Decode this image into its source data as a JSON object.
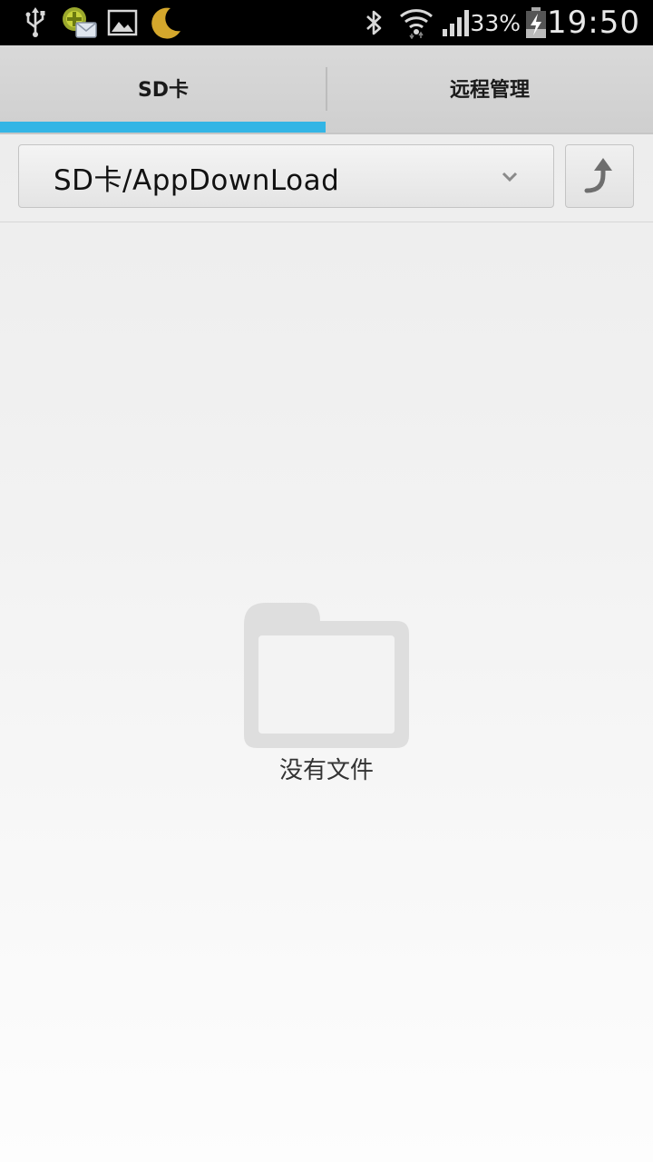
{
  "status_bar": {
    "battery_percent": "33%",
    "time": "19:50",
    "icons": [
      "usb-icon",
      "app-notification-icon",
      "image-icon",
      "moon-icon",
      "bluetooth-icon",
      "wifi-icon",
      "signal-icon",
      "battery-charging-icon"
    ],
    "moon_color": "#d4a72c"
  },
  "tabs": [
    {
      "label": "SD卡",
      "active": true
    },
    {
      "label": "远程管理",
      "active": false
    }
  ],
  "accent_color": "#33b5e5",
  "path_bar": {
    "current_path": "SD卡/AppDownLoad",
    "dropdown_icon": "chevron-down-icon",
    "up_icon": "up-directory-icon"
  },
  "empty_state": {
    "icon": "folder-icon",
    "message": "没有文件"
  }
}
